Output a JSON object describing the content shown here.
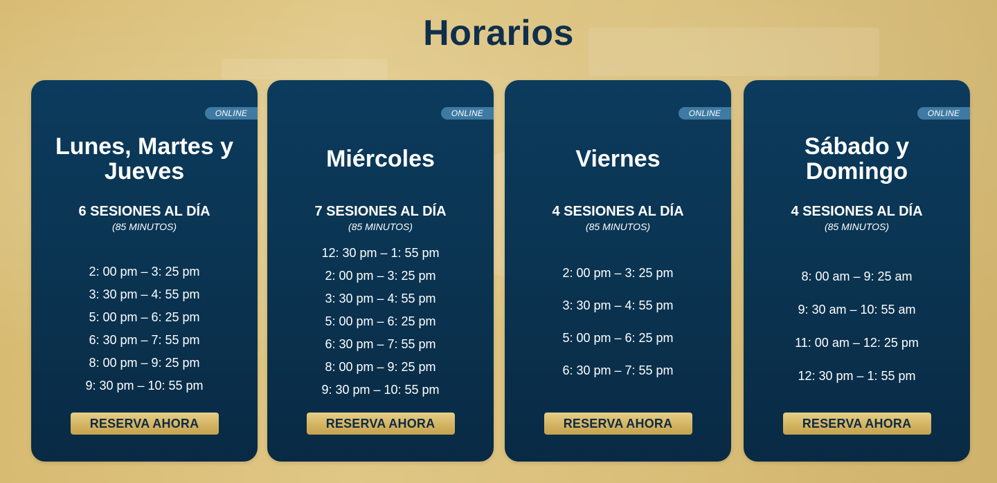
{
  "page": {
    "title": "Horarios"
  },
  "colors": {
    "background": "#dcc07a",
    "title": "#0f2f4c",
    "card": "#0a3350",
    "badge": "#3e7aa2",
    "button": "#d4b462",
    "button_text": "#0d2a44"
  },
  "cards": [
    {
      "badge": "ONLINE",
      "day": "Lunes, Martes y Jueves",
      "sessions": "6 SESIONES AL DÍA",
      "duration": "(85 MINUTOS)",
      "times": [
        "2: 00 pm – 3: 25 pm",
        "3: 30 pm – 4: 55 pm",
        "5: 00 pm – 6: 25 pm",
        "6: 30 pm – 7: 55 pm",
        "8: 00 pm – 9: 25 pm",
        "9: 30 pm – 10: 55 pm"
      ],
      "button": "RESERVA AHORA"
    },
    {
      "badge": "ONLINE",
      "day": "Miércoles",
      "sessions": "7 SESIONES AL DÍA",
      "duration": "(85 MINUTOS)",
      "times": [
        "12: 30 pm – 1: 55 pm",
        "2: 00 pm – 3: 25 pm",
        "3: 30 pm – 4: 55 pm",
        "5: 00 pm – 6: 25 pm",
        "6: 30 pm – 7: 55 pm",
        "8: 00 pm – 9: 25 pm",
        "9: 30 pm – 10: 55 pm"
      ],
      "button": "RESERVA AHORA"
    },
    {
      "badge": "ONLINE",
      "day": "Viernes",
      "sessions": "4 SESIONES AL DÍA",
      "duration": "(85 MINUTOS)",
      "times": [
        "2: 00 pm – 3: 25 pm",
        "3: 30 pm – 4: 55 pm",
        "5: 00 pm – 6: 25 pm",
        "6: 30 pm – 7: 55 pm"
      ],
      "button": "RESERVA AHORA"
    },
    {
      "badge": "ONLINE",
      "day": "Sábado y Domingo",
      "sessions": "4 SESIONES AL DÍA",
      "duration": "(85 MINUTOS)",
      "times": [
        "8: 00 am – 9: 25 am",
        "9: 30 am – 10: 55 am",
        "11: 00 am – 12: 25 pm",
        "12: 30 pm – 1: 55 pm"
      ],
      "button": "RESERVA AHORA"
    }
  ]
}
